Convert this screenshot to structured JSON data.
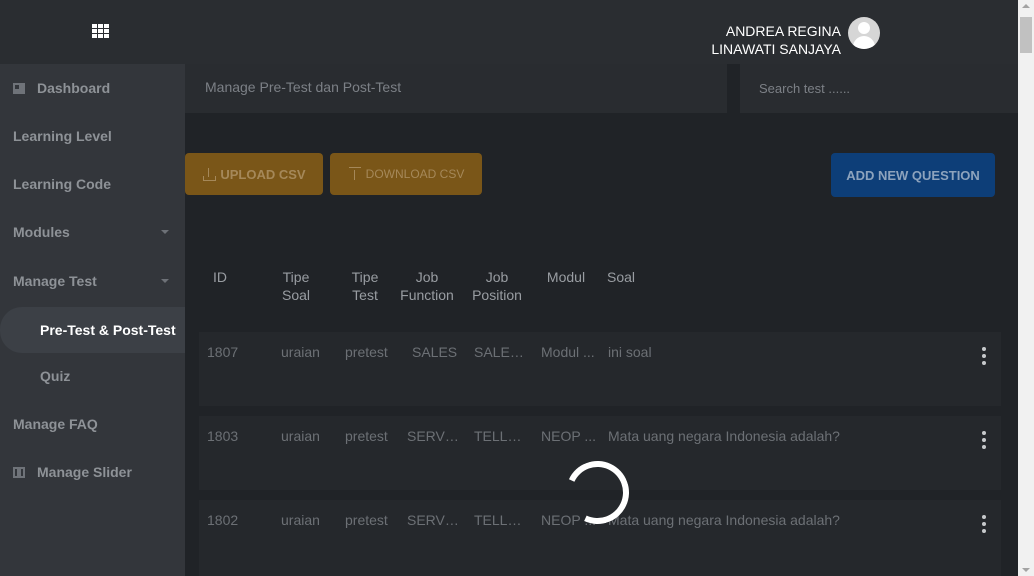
{
  "header": {
    "user_name_line1": "ANDREA REGINA",
    "user_name_line2": "LINAWATI SANJAYA",
    "menu_icon": "grid-icon",
    "avatar_icon": "user-avatar-icon"
  },
  "sidebar": {
    "items": [
      {
        "label": "Dashboard",
        "icon": "dashboard-icon"
      },
      {
        "label": "Learning Level"
      },
      {
        "label": "Learning Code"
      },
      {
        "label": "Modules",
        "expandable": true
      },
      {
        "label": "Manage Test",
        "expandable": true
      },
      {
        "label": "Pre-Test & Post-Test",
        "active": true
      },
      {
        "label": "Quiz"
      },
      {
        "label": "Manage FAQ"
      },
      {
        "label": "Manage Slider",
        "icon": "slider-icon"
      }
    ]
  },
  "page": {
    "title": "Manage Pre-Test dan Post-Test",
    "search_placeholder": "Search test ......"
  },
  "toolbar": {
    "upload_label": "UPLOAD CSV",
    "download_label": "DOWNLOAD CSV",
    "add_label": "ADD NEW QUESTION"
  },
  "colors": {
    "upload_button": "#7a5618",
    "add_button": "#0d3e78",
    "background": "#202327",
    "sidebar": "#33363b"
  },
  "table": {
    "columns": [
      {
        "line1": "ID",
        "line2": ""
      },
      {
        "line1": "Tipe",
        "line2": "Soal"
      },
      {
        "line1": "Tipe",
        "line2": "Test"
      },
      {
        "line1": "Job",
        "line2": "Function"
      },
      {
        "line1": "Job",
        "line2": "Position"
      },
      {
        "line1": "Modul",
        "line2": ""
      },
      {
        "line1": "Soal",
        "line2": ""
      }
    ],
    "rows": [
      {
        "id": "1807",
        "tipe_soal": "uraian",
        "tipe_test": "pretest",
        "job_function": "SALES",
        "job_position": "SALES...",
        "modul": "Modul ...",
        "soal": "ini soal"
      },
      {
        "id": "1803",
        "tipe_soal": "uraian",
        "tipe_test": "pretest",
        "job_function": "SERVI...",
        "job_position": "TELLE...",
        "modul": "NEOP ...",
        "soal": "Mata uang negara Indonesia adalah?"
      },
      {
        "id": "1802",
        "tipe_soal": "uraian",
        "tipe_test": "pretest",
        "job_function": "SERVI...",
        "job_position": "TELLE...",
        "modul": "NEOP ...",
        "soal": "Mata uang negara Indonesia adalah?"
      }
    ]
  },
  "loading": true
}
